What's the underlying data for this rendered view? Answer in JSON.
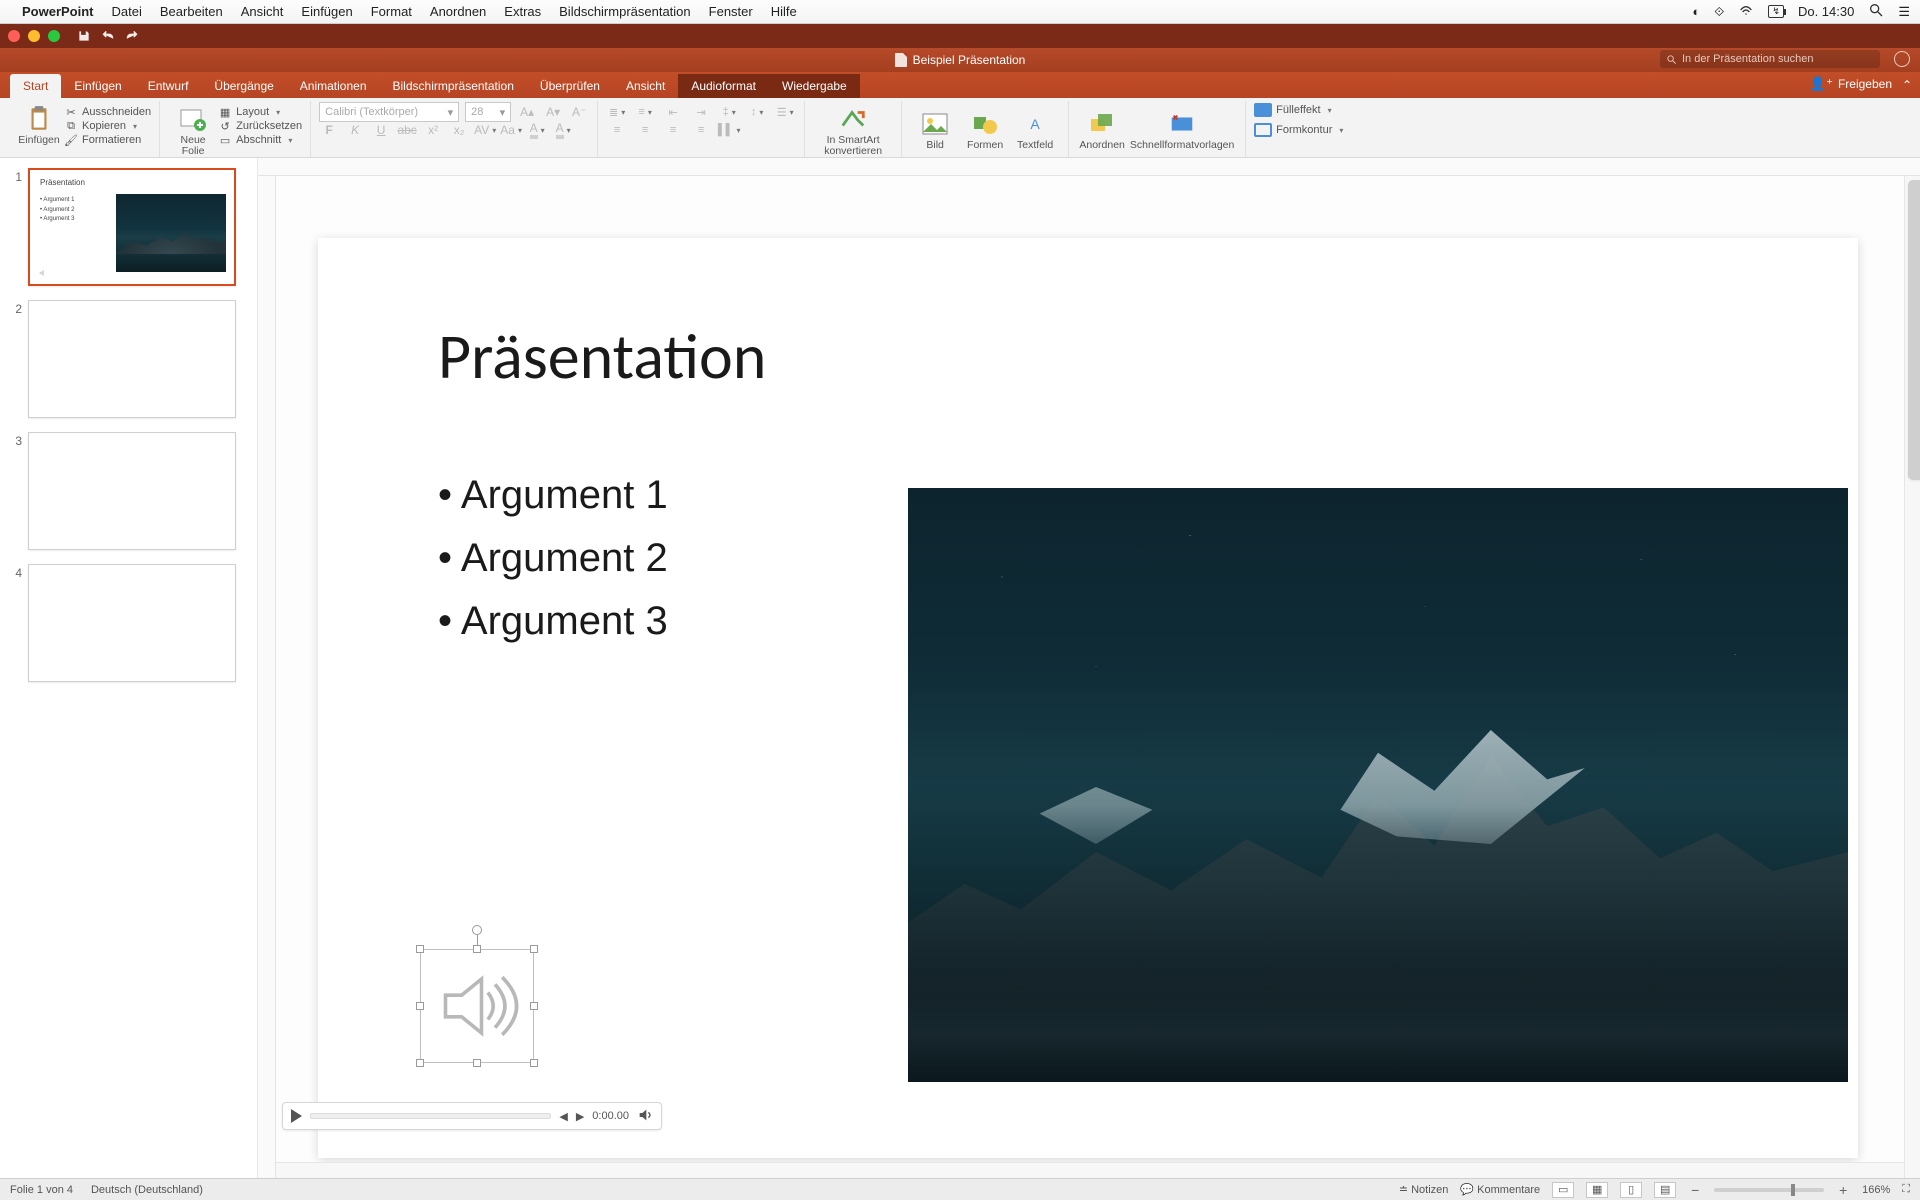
{
  "mac_menu": {
    "app": "PowerPoint",
    "items": [
      "Datei",
      "Bearbeiten",
      "Ansicht",
      "Einfügen",
      "Format",
      "Anordnen",
      "Extras",
      "Bildschirmpräsentation",
      "Fenster",
      "Hilfe"
    ],
    "battery": "↯",
    "day_time": "Do. 14:30"
  },
  "title": {
    "doc": "Beispiel Präsentation",
    "search_placeholder": "In der Präsentation suchen"
  },
  "tabs": {
    "items": [
      "Start",
      "Einfügen",
      "Entwurf",
      "Übergänge",
      "Animationen",
      "Bildschirmpräsentation",
      "Überprüfen",
      "Ansicht",
      "Audioformat",
      "Wiedergabe"
    ],
    "active_index": 0,
    "context_indexes": [
      8,
      9
    ],
    "share": "Freigeben"
  },
  "ribbon": {
    "paste": "Einfügen",
    "cut": "Ausschneiden",
    "copy": "Kopieren",
    "format_painter": "Formatieren",
    "new_slide": "Neue\nFolie",
    "layout": "Layout",
    "reset": "Zurücksetzen",
    "section": "Abschnitt",
    "font_name": "Calibri (Textkörper)",
    "font_size": "28",
    "smartart": "In SmartArt\nkonvertieren",
    "picture": "Bild",
    "shapes": "Formen",
    "textbox": "Textfeld",
    "arrange": "Anordnen",
    "quickstyles": "Schnellformatvorlagen",
    "shape_fill": "Fülleffekt",
    "shape_outline": "Formkontur"
  },
  "slide": {
    "title": "Präsentation",
    "bullets": [
      "Argument 1",
      "Argument 2",
      "Argument 3"
    ]
  },
  "thumb1": {
    "title": "Präsentation",
    "b1": "• Argument 1",
    "b2": "• Argument 2",
    "b3": "• Argument 3"
  },
  "audio": {
    "time": "0:00.00"
  },
  "status": {
    "slide_info": "Folie 1 von 4",
    "language": "Deutsch (Deutschland)",
    "notes": "Notizen",
    "comments": "Kommentare",
    "zoom": "166%"
  },
  "thumb_numbers": [
    "1",
    "2",
    "3",
    "4"
  ]
}
